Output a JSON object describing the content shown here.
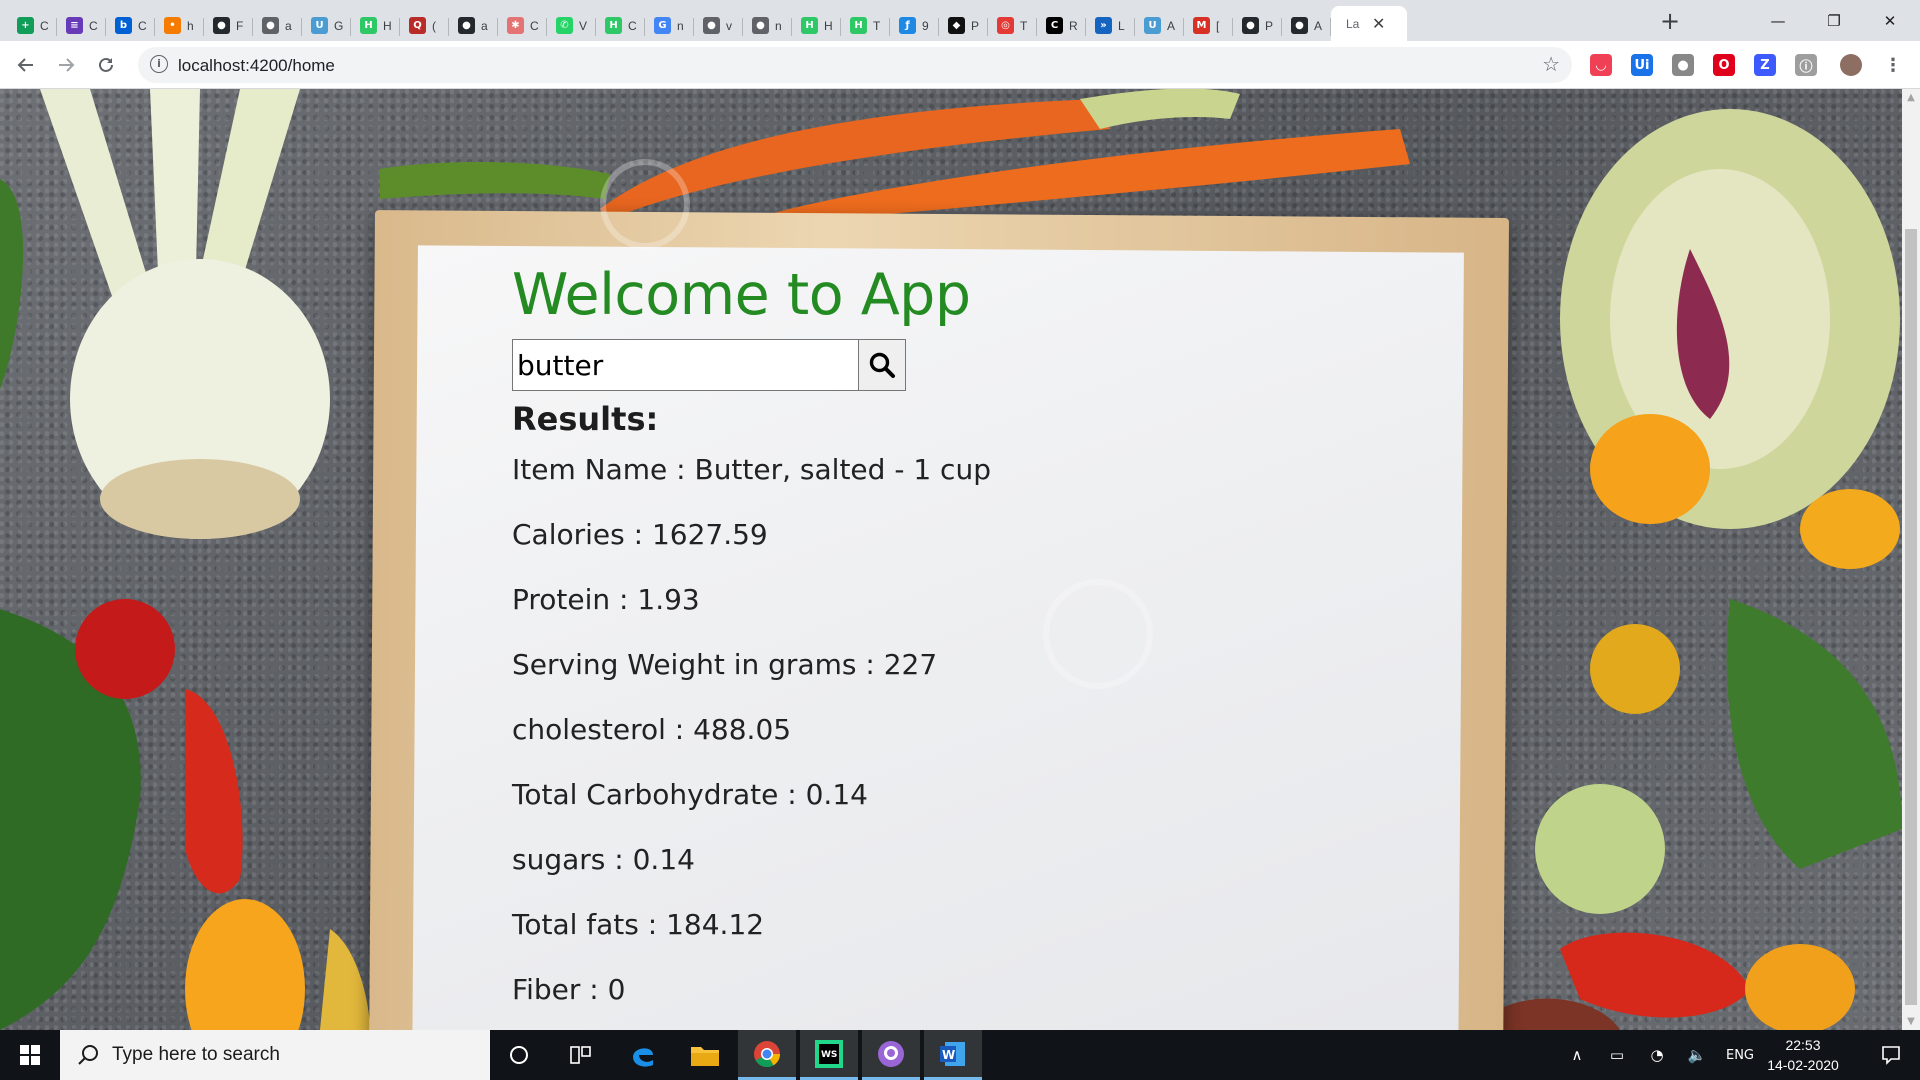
{
  "browser": {
    "tabs": [
      {
        "icon": "sheets-icon",
        "color": "#0f9d58",
        "glyph": "+",
        "title": "C"
      },
      {
        "icon": "forms-icon",
        "color": "#673ab7",
        "glyph": "≡",
        "title": "C"
      },
      {
        "icon": "box-icon",
        "color": "#0061d5",
        "glyph": "b",
        "title": "C"
      },
      {
        "icon": "dots-icon",
        "color": "#f57c00",
        "glyph": "•",
        "title": "h"
      },
      {
        "icon": "github-icon",
        "color": "#24292e",
        "glyph": "●",
        "title": "F"
      },
      {
        "icon": "globe-icon",
        "color": "#5f6368",
        "glyph": "●",
        "title": "a"
      },
      {
        "icon": "unc-icon",
        "color": "#4b9cd3",
        "glyph": "U",
        "title": "G"
      },
      {
        "icon": "hackerrank-icon",
        "color": "#2ec866",
        "glyph": "H",
        "title": "H"
      },
      {
        "icon": "quora-icon",
        "color": "#b92b27",
        "glyph": "Q",
        "title": "("
      },
      {
        "icon": "github-icon",
        "color": "#24292e",
        "glyph": "●",
        "title": "a"
      },
      {
        "icon": "figure-icon",
        "color": "#e57373",
        "glyph": "✱",
        "title": "C"
      },
      {
        "icon": "whatsapp-icon",
        "color": "#25d366",
        "glyph": "✆",
        "title": "V"
      },
      {
        "icon": "hackerrank-icon",
        "color": "#2ec866",
        "glyph": "H",
        "title": "C"
      },
      {
        "icon": "google-icon",
        "color": "#4285f4",
        "glyph": "G",
        "title": "n"
      },
      {
        "icon": "globe-icon",
        "color": "#5f6368",
        "glyph": "●",
        "title": "v"
      },
      {
        "icon": "globe-icon",
        "color": "#5f6368",
        "glyph": "●",
        "title": "n"
      },
      {
        "icon": "hackerrank-icon",
        "color": "#2ec866",
        "glyph": "H",
        "title": "H"
      },
      {
        "icon": "hackerrank-icon",
        "color": "#2ec866",
        "glyph": "H",
        "title": "T"
      },
      {
        "icon": "function-icon",
        "color": "#1e88e5",
        "glyph": "ƒ",
        "title": "9"
      },
      {
        "icon": "codepen-icon",
        "color": "#111111",
        "glyph": "◆",
        "title": "P"
      },
      {
        "icon": "target-icon",
        "color": "#e53935",
        "glyph": "◎",
        "title": "T"
      },
      {
        "icon": "c-icon",
        "color": "#000000",
        "glyph": "C",
        "title": "R"
      },
      {
        "icon": "arrows-icon",
        "color": "#1565c0",
        "glyph": "»",
        "title": "L"
      },
      {
        "icon": "unc-icon",
        "color": "#4b9cd3",
        "glyph": "U",
        "title": "A"
      },
      {
        "icon": "gmail-icon",
        "color": "#d93025",
        "glyph": "M",
        "title": "["
      },
      {
        "icon": "github-icon",
        "color": "#24292e",
        "glyph": "●",
        "title": "P"
      },
      {
        "icon": "github-icon",
        "color": "#24292e",
        "glyph": "●",
        "title": "A"
      }
    ],
    "active_tab": {
      "title": "La",
      "close": "✕"
    },
    "new_tab": "+",
    "window_controls": {
      "minimize": "—",
      "restore": "❐",
      "close": "✕"
    },
    "url": "localhost:4200/home",
    "extensions": [
      {
        "icon": "pocket-icon",
        "color": "#ef4056",
        "glyph": "◡"
      },
      {
        "icon": "uipath-icon",
        "color": "#1a73e8",
        "glyph": "Ui"
      },
      {
        "icon": "circle-ext-icon",
        "color": "#888888",
        "glyph": "●"
      },
      {
        "icon": "opera-icon",
        "color": "#e0001b",
        "glyph": "O"
      },
      {
        "icon": "zotero-icon",
        "color": "#3d5afe",
        "glyph": "Z"
      },
      {
        "icon": "info-ext-icon",
        "color": "#9e9e9e",
        "glyph": "ⓘ"
      }
    ]
  },
  "app": {
    "heading": "Welcome to App",
    "search": {
      "value": "butter"
    },
    "results_label": "Results:",
    "results": [
      "Item Name : Butter, salted - 1 cup",
      "Calories : 1627.59",
      "Protein : 1.93",
      "Serving Weight in grams : 227",
      "cholesterol : 488.05",
      "Total Carbohydrate : 0.14",
      "sugars : 0.14",
      "Total fats : 184.12",
      "Fiber : 0"
    ],
    "colors": {
      "heading": "#238b22"
    }
  },
  "taskbar": {
    "search_placeholder": "Type here to search",
    "apps": [
      {
        "name": "cortana-icon"
      },
      {
        "name": "task-view-icon"
      },
      {
        "name": "edge-icon"
      },
      {
        "name": "file-explorer-icon"
      },
      {
        "name": "chrome-icon"
      },
      {
        "name": "webstorm-icon"
      },
      {
        "name": "github-desktop-icon"
      },
      {
        "name": "word-icon"
      }
    ],
    "tray": {
      "language": "ENG",
      "time": "22:53",
      "date": "14-02-2020"
    }
  }
}
